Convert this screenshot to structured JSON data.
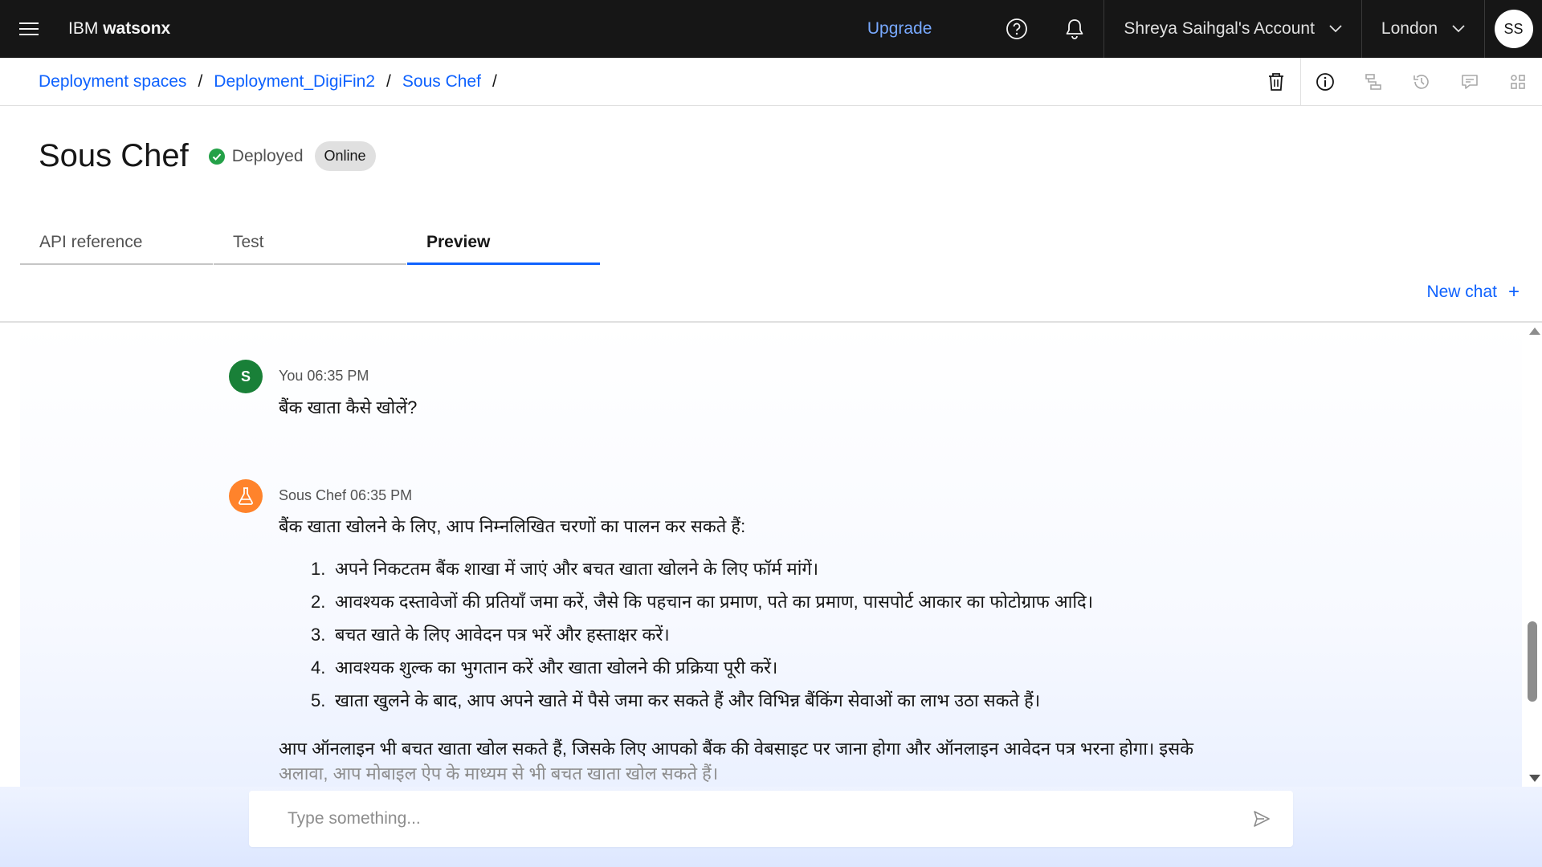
{
  "header": {
    "brand_prefix": "IBM",
    "brand_name": "watsonx",
    "upgrade": "Upgrade",
    "account": "Shreya Saihgal's Account",
    "region": "London",
    "avatar_initials": "SS"
  },
  "breadcrumb": {
    "items": [
      "Deployment spaces",
      "Deployment_DigiFin2",
      "Sous Chef"
    ],
    "separator": "/"
  },
  "page": {
    "title": "Sous Chef",
    "status": "Deployed",
    "tag": "Online"
  },
  "tabs": [
    {
      "label": "API reference",
      "active": false
    },
    {
      "label": "Test",
      "active": false
    },
    {
      "label": "Preview",
      "active": true
    }
  ],
  "new_chat": {
    "label": "New chat",
    "icon": "plus-icon"
  },
  "chat": {
    "user_message": {
      "avatar_initial": "S",
      "meta": "You 06:35 PM",
      "text": "बैंक खाता कैसे खोलें?"
    },
    "assistant_message": {
      "avatar_icon": "flask-icon",
      "meta": "Sous Chef 06:35 PM",
      "intro": "बैंक खाता खोलने के लिए, आप निम्नलिखित चरणों का पालन कर सकते हैं:",
      "steps": [
        {
          "num": "1.",
          "text": "अपने निकटतम बैंक शाखा में जाएं और बचत खाता खोलने के लिए फॉर्म मांगें।"
        },
        {
          "num": "2.",
          "text": "आवश्यक दस्तावेजों की प्रतियाँ जमा करें, जैसे कि पहचान का प्रमाण, पते का प्रमाण, पासपोर्ट आकार का फोटोग्राफ आदि।"
        },
        {
          "num": "3.",
          "text": "बचत खाते के लिए आवेदन पत्र भरें और हस्ताक्षर करें।"
        },
        {
          "num": "4.",
          "text": "आवश्यक शुल्क का भुगतान करें और खाता खोलने की प्रक्रिया पूरी करें।"
        },
        {
          "num": "5.",
          "text": "खाता खुलने के बाद, आप अपने खाते में पैसे जमा कर सकते हैं और विभिन्न बैंकिंग सेवाओं का लाभ उठा सकते हैं।"
        }
      ],
      "outro_line1": "आप ऑनलाइन भी बचत खाता खोल सकते हैं, जिसके लिए आपको बैंक की वेबसाइट पर जाना होगा और ऑनलाइन आवेदन पत्र भरना होगा। इसके",
      "outro_line2": "अलावा, आप मोबाइल ऐप के माध्यम से भी बचत खाता खोल सकते हैं।"
    }
  },
  "input": {
    "placeholder": "Type something...",
    "value": ""
  },
  "colors": {
    "accent": "#0f62fe",
    "user_avatar": "#198038",
    "assistant_avatar": "#ff832b",
    "deployed": "#24a148",
    "header_bg": "#161616"
  }
}
